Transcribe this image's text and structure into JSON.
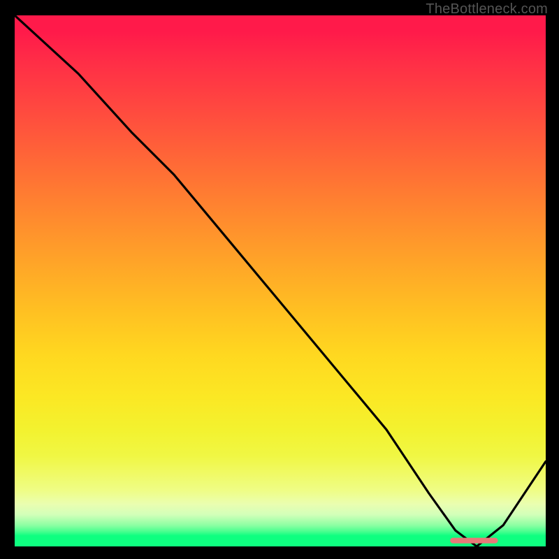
{
  "watermark": "TheBottleneck.com",
  "chart_data": {
    "type": "line",
    "title": "",
    "xlabel": "",
    "ylabel": "",
    "xlim": [
      0,
      100
    ],
    "ylim": [
      0,
      100
    ],
    "grid": false,
    "series": [
      {
        "name": "bottleneck-curve",
        "x": [
          0,
          12,
          22,
          30,
          40,
          50,
          60,
          70,
          78,
          83,
          87,
          92,
          100
        ],
        "values": [
          100,
          89,
          78,
          70,
          58,
          46,
          34,
          22,
          10,
          3,
          0,
          4,
          16
        ]
      }
    ],
    "marker": {
      "name": "optimal-range",
      "x_start": 82,
      "x_end": 91,
      "y": 1.1,
      "color": "#e77a78"
    },
    "colors": {
      "line": "#000000",
      "background_gradient_top": "#ff1a4a",
      "background_gradient_bottom": "#0eff80",
      "marker": "#e77a78"
    }
  }
}
